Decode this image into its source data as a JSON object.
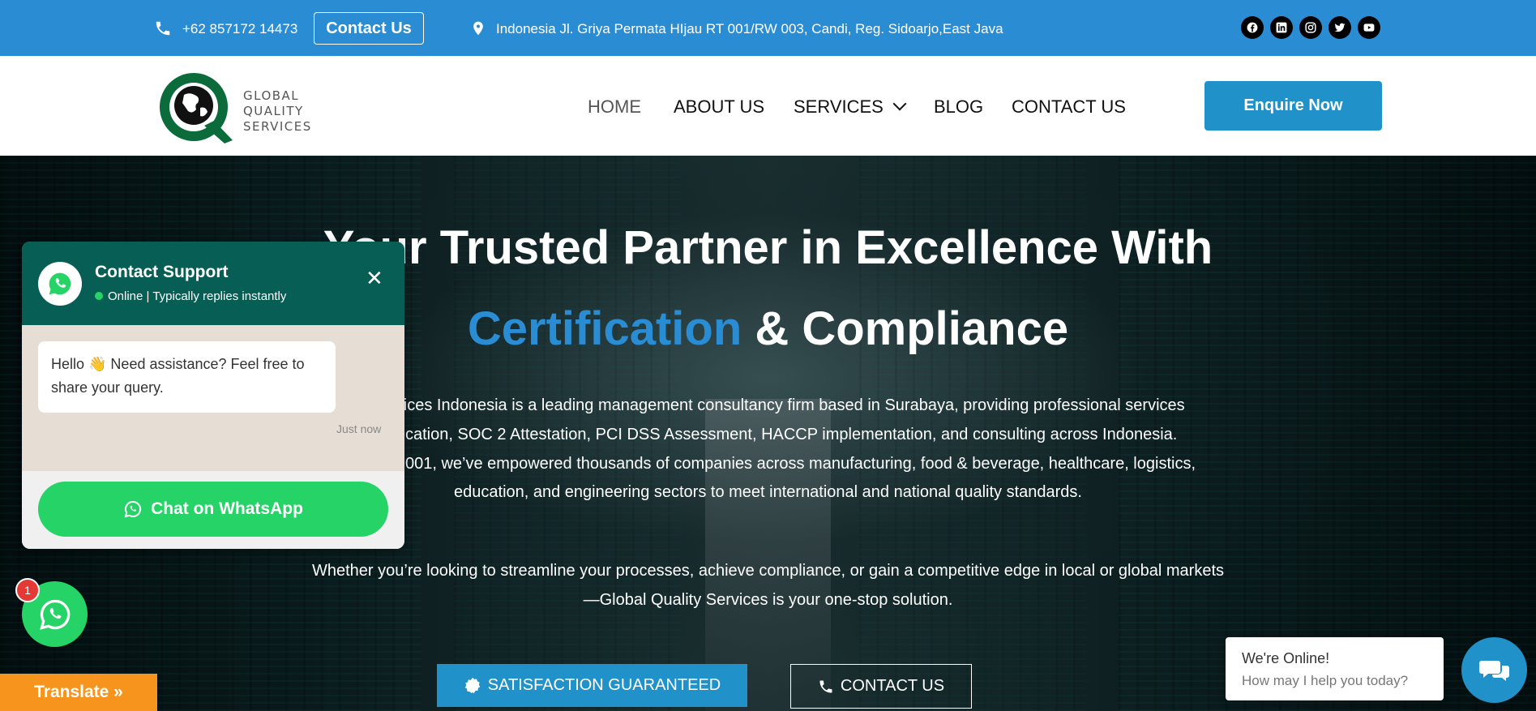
{
  "topbar": {
    "phone": "+62 857172 14473",
    "contact_button": "Contact Us",
    "address": "Indonesia Jl. Griya Permata HIjau RT 001/RW 003, Candi, Reg. Sidoarjo,East Java",
    "social_icons": [
      "facebook-icon",
      "linkedin-icon",
      "instagram-icon",
      "twitter-icon",
      "youtube-icon"
    ]
  },
  "brand": {
    "logo_line1": "GLOBAL",
    "logo_line2": "QUALITY",
    "logo_line3": "SERVICES",
    "green": "#0b6b3a",
    "blue": "#2a8dd4"
  },
  "nav": {
    "items": [
      {
        "label": "HOME"
      },
      {
        "label": "ABOUT US"
      },
      {
        "label": "SERVICES"
      },
      {
        "label": "BLOG"
      },
      {
        "label": "CONTACT US"
      }
    ],
    "enquire": "Enquire Now"
  },
  "hero": {
    "title_line1": "Your Trusted Partner in Excellence With",
    "title_accent": "Certification",
    "title_rest": " & Compliance",
    "para1_line1": "ervices Indonesia is a leading management consultancy firm based in Surabaya, providing professional services",
    "para1_line2": "cation, SOC 2 Attestation, PCI DSS Assessment, HACCP implementation, and consulting across Indonesia.",
    "para1_line3": "001, we’ve empowered thousands of companies across manufacturing, food & beverage, healthcare, logistics,",
    "para1_line4": "education, and engineering sectors to meet international and national quality standards.",
    "para2_line1": "Whether you’re looking to streamline your processes, achieve compliance, or gain a competitive edge in local or global markets",
    "para2_line2": "—Global Quality Services is your one-stop solution.",
    "btn_satisfaction": "SATISFACTION GUARANTEED",
    "btn_contact": "CONTACT US"
  },
  "chat": {
    "title": "Contact Support",
    "status": "Online | Typically replies instantly",
    "message": "Hello 👋 Need assistance? Feel free to share your query.",
    "time": "Just now",
    "cta": "Chat on WhatsApp",
    "badge": "1"
  },
  "translate": "Translate »",
  "live_chat": {
    "title": "We're Online!",
    "subtitle": "How may I help you today?"
  }
}
